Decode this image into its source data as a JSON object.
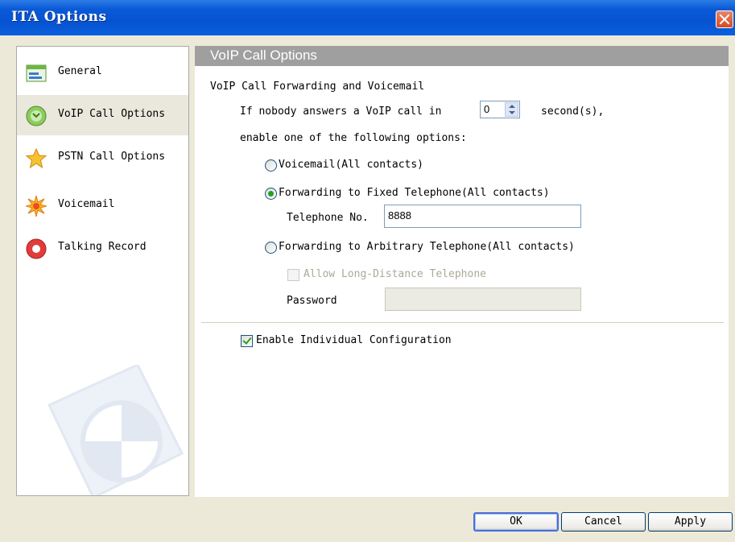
{
  "window": {
    "title": "ITA Options"
  },
  "sidebar": {
    "items": [
      {
        "label": "General",
        "icon": "general-icon",
        "selected": false
      },
      {
        "label": "VoIP Call Options",
        "icon": "voip-icon",
        "selected": true
      },
      {
        "label": "PSTN Call Options",
        "icon": "pstn-icon",
        "selected": false
      },
      {
        "label": "Voicemail",
        "icon": "voicemail-icon",
        "selected": false
      },
      {
        "label": "Talking Record",
        "icon": "record-icon",
        "selected": false
      }
    ]
  },
  "panel": {
    "header": "VoIP Call Options",
    "section_title": "VoIP Call Forwarding and Voicemail",
    "line1_prefix": "If nobody answers a VoIP call in",
    "seconds_value": "0",
    "line1_suffix": "second(s),",
    "line2": "enable one of the following options:",
    "options": {
      "voicemail": {
        "label": "Voicemail(All contacts)",
        "checked": false
      },
      "fixed": {
        "label": "Forwarding to Fixed Telephone(All contacts)",
        "checked": true
      },
      "arbitrary": {
        "label": "Forwarding to Arbitrary Telephone(All contacts)",
        "checked": false
      }
    },
    "telephone_label": "Telephone No.",
    "telephone_value": "8888",
    "long_distance_label": "Allow Long-Distance Telephone",
    "long_distance_checked": false,
    "password_label": "Password",
    "password_value": "",
    "individual_config_label": "Enable Individual Configuration",
    "individual_config_checked": true
  },
  "buttons": {
    "ok": "OK",
    "cancel": "Cancel",
    "apply": "Apply"
  },
  "colors": {
    "titlebar": "#0653D0",
    "panel_header": "#9F9F9F",
    "window_bg": "#ECE9D8",
    "check_green": "#21A121",
    "close_red": "#D44A26"
  }
}
